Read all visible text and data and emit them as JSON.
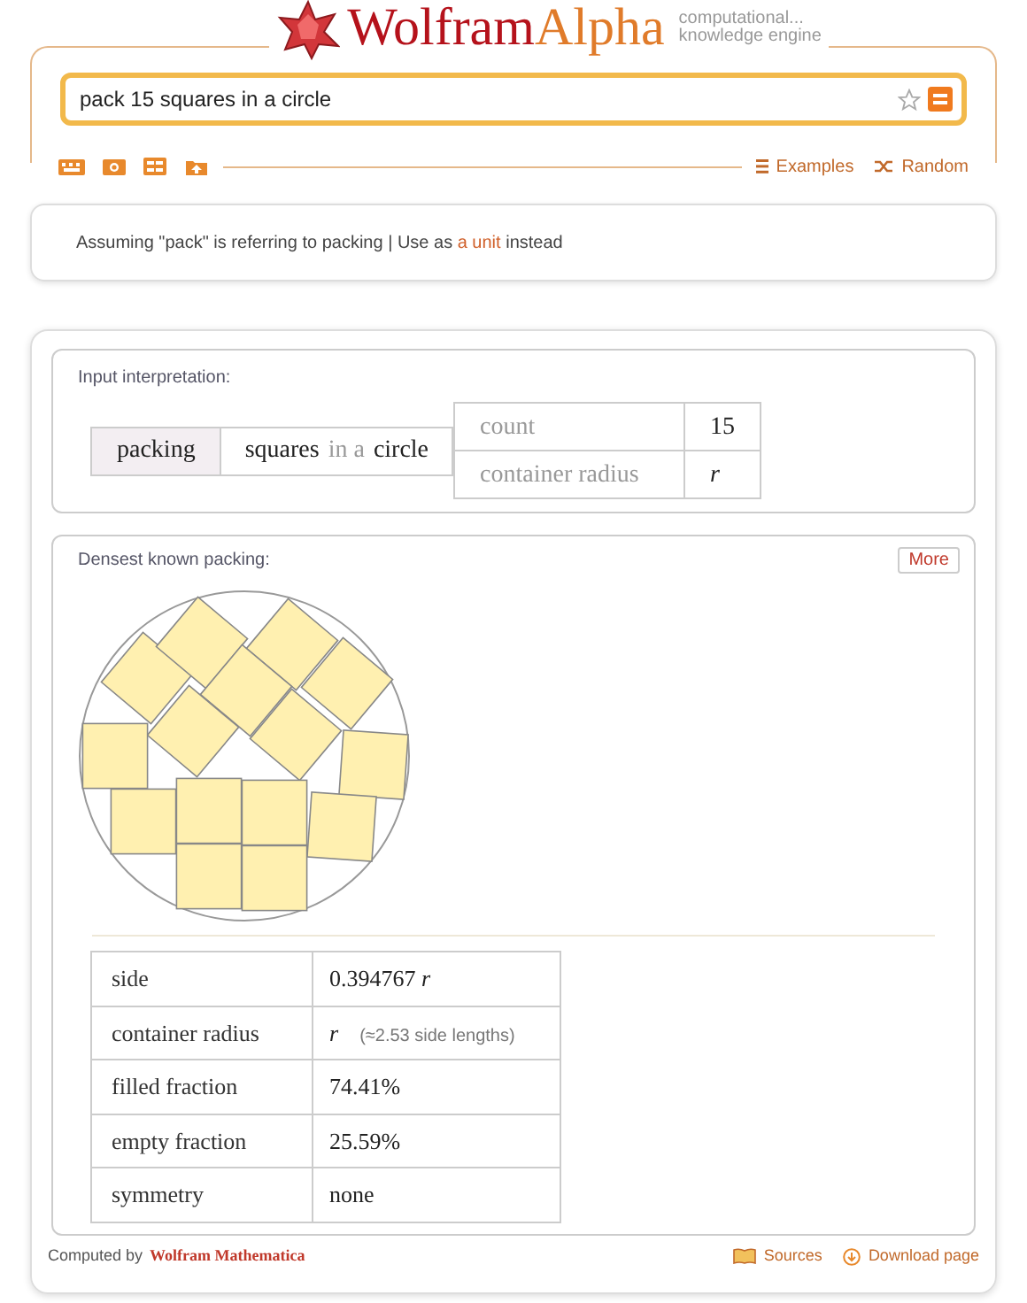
{
  "header": {
    "logo_first": "Wolfram",
    "logo_second": "Alpha",
    "tagline": [
      "computational...",
      "knowledge engine"
    ]
  },
  "search": {
    "value": "pack 15 squares in a circle"
  },
  "links": [
    {
      "kind": "examples",
      "label": "Examples"
    },
    {
      "kind": "random",
      "label": "Random"
    }
  ],
  "assumption": {
    "text": "Assuming \"pack\" is referring to packing | Use as",
    "link": "a unit",
    "after": "instead"
  },
  "input_interpretation": {
    "title": "Input interpretation:",
    "head": "packing",
    "subject": [
      {
        "text": "squares",
        "muted": false
      },
      {
        "text": "in a",
        "muted": true
      },
      {
        "text": "circle",
        "muted": false
      }
    ],
    "params": [
      {
        "name": "count",
        "value": "15",
        "kind": "number"
      },
      {
        "name": "container radius",
        "value": "r",
        "kind": "symbol"
      }
    ]
  },
  "packing": {
    "title": "Densest known packing:",
    "more": "More",
    "rows": [
      {
        "name": "side",
        "value": "0.394767 *r*",
        "kind": "number"
      },
      {
        "name": "container radius",
        "value": "r",
        "kind": "symbol",
        "note": "(≈2.53 side lengths)"
      },
      {
        "name": "filled fraction",
        "value": "74.41%",
        "kind": "number"
      },
      {
        "name": "empty fraction",
        "value": "25.59%",
        "kind": "number"
      },
      {
        "name": "symmetry",
        "value": "none",
        "kind": "number"
      }
    ]
  },
  "footer": {
    "computed_by": "Computed by",
    "engine": "Wolfram Mathematica",
    "sources": "Sources",
    "download": "Download page"
  }
}
